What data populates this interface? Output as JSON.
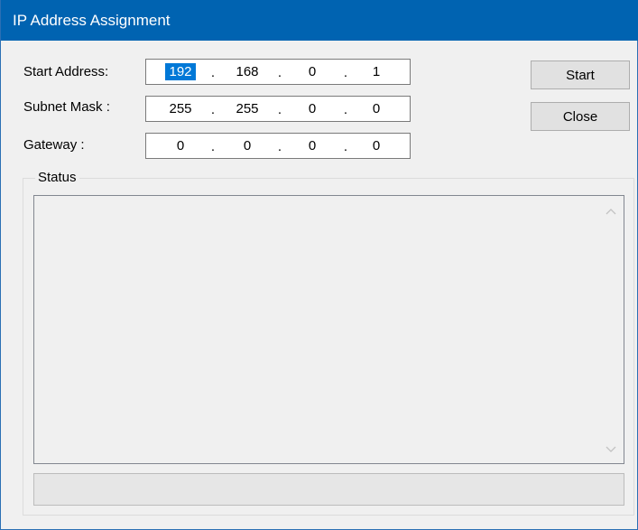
{
  "window": {
    "title": "IP Address Assignment"
  },
  "fields": {
    "start_address": {
      "label": "Start Address:",
      "octets": [
        "192",
        "168",
        "0",
        "1"
      ],
      "separator": "."
    },
    "subnet_mask": {
      "label": "Subnet Mask :",
      "octets": [
        "255",
        "255",
        "0",
        "0"
      ],
      "separator": "."
    },
    "gateway": {
      "label": "Gateway :",
      "octets": [
        "0",
        "0",
        "0",
        "0"
      ],
      "separator": "."
    }
  },
  "buttons": {
    "start_label": "Start",
    "close_label": "Close"
  },
  "status": {
    "group_label": "Status",
    "log_text": ""
  },
  "progress": {
    "value": 0
  },
  "icons": {
    "scroll_up": "chevron-up-icon",
    "scroll_down": "chevron-down-icon"
  },
  "colors": {
    "titlebar": "#0063b1",
    "selection": "#0078d7",
    "window_bg": "#f0f0f0"
  }
}
